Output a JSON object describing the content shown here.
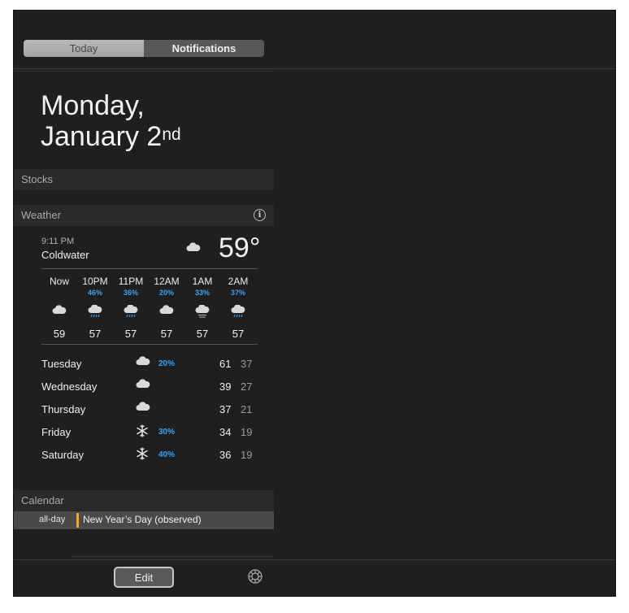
{
  "segments": {
    "today": "Today",
    "notifications": "Notifications"
  },
  "date": {
    "line1": "Monday,",
    "line2": "January 2",
    "suffix": "nd"
  },
  "sections": {
    "stocks": "Stocks",
    "weather": "Weather",
    "calendar": "Calendar"
  },
  "weather": {
    "time": "9:11 PM",
    "city": "Coldwater",
    "current_icon": "cloud-icon",
    "temp": "59°",
    "hourly": [
      {
        "label": "Now",
        "pct": "",
        "icon": "cloud-icon",
        "temp": "59"
      },
      {
        "label": "10PM",
        "pct": "46%",
        "icon": "rain-cloud-icon",
        "temp": "57"
      },
      {
        "label": "11PM",
        "pct": "36%",
        "icon": "rain-cloud-icon",
        "temp": "57"
      },
      {
        "label": "12AM",
        "pct": "20%",
        "icon": "cloud-icon",
        "temp": "57"
      },
      {
        "label": "1AM",
        "pct": "33%",
        "icon": "fog-cloud-icon",
        "temp": "57"
      },
      {
        "label": "2AM",
        "pct": "37%",
        "icon": "rain-cloud-icon",
        "temp": "57"
      }
    ],
    "daily": [
      {
        "day": "Tuesday",
        "icon": "cloud-icon",
        "pct": "20%",
        "hi": "61",
        "lo": "37"
      },
      {
        "day": "Wednesday",
        "icon": "cloud-icon",
        "pct": "",
        "hi": "39",
        "lo": "27"
      },
      {
        "day": "Thursday",
        "icon": "cloud-icon",
        "pct": "",
        "hi": "37",
        "lo": "21"
      },
      {
        "day": "Friday",
        "icon": "snowflake-icon",
        "pct": "30%",
        "hi": "34",
        "lo": "19"
      },
      {
        "day": "Saturday",
        "icon": "snowflake-icon",
        "pct": "40%",
        "hi": "36",
        "lo": "19"
      }
    ],
    "accent_color": "#3aa3f5"
  },
  "calendar": {
    "allday": "all-day",
    "event": "New Year’s Day (observed)",
    "event_color": "#f5a623"
  },
  "footer": {
    "edit": "Edit"
  }
}
